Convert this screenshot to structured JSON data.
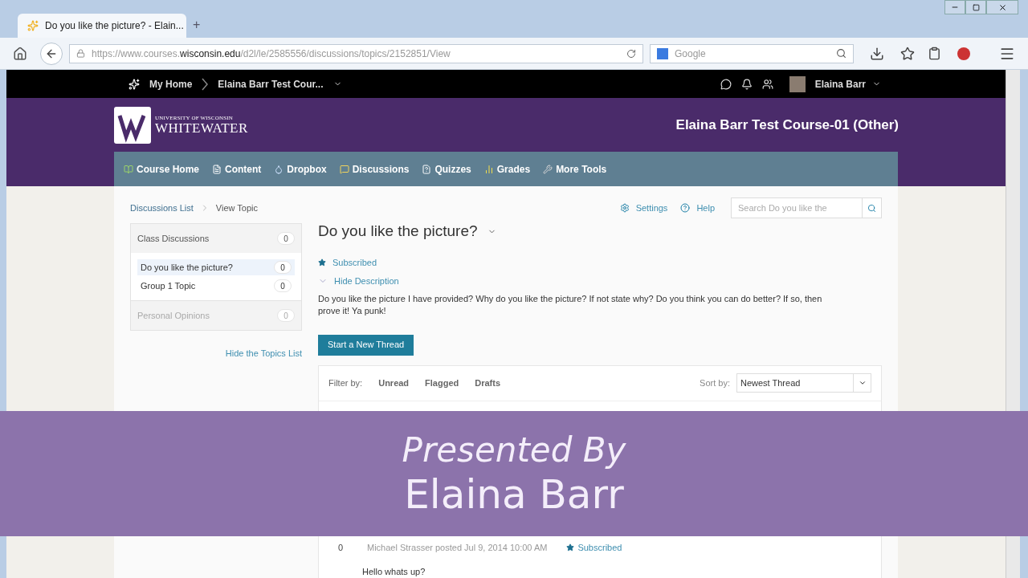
{
  "browser": {
    "tab_title": "Do you like the picture? - Elain...",
    "new_tab": "+",
    "url_prefix": "https://www.courses.",
    "url_domain": "wisconsin.edu",
    "url_rest": "/d2l/le/2585556/discussions/topics/2152851/View",
    "search_placeholder": "Google"
  },
  "topbar": {
    "home": "My Home",
    "course": "Elaina Barr Test Cour...",
    "user": "Elaina Barr"
  },
  "header": {
    "logo_top": "UNIVERSITY OF WISCONSIN",
    "logo_main": "WHITEWATER",
    "course_title": "Elaina Barr Test Course-01 (Other)"
  },
  "nav": [
    {
      "label": "Course Home",
      "kind": "book"
    },
    {
      "label": "Content",
      "kind": "page"
    },
    {
      "label": "Dropbox",
      "kind": "drop"
    },
    {
      "label": "Discussions",
      "kind": "chat"
    },
    {
      "label": "Quizzes",
      "kind": "quiz"
    },
    {
      "label": "Grades",
      "kind": "grade"
    },
    {
      "label": "More Tools",
      "kind": "tools"
    }
  ],
  "breadcrumbs": [
    "Discussions List",
    "View Topic"
  ],
  "tools": {
    "settings": "Settings",
    "help": "Help",
    "search_placeholder": "Search Do you like the"
  },
  "forums": [
    {
      "name": "Class Discussions",
      "count": "0",
      "disabled": false,
      "topics": [
        {
          "name": "Do you like the picture?",
          "count": "0",
          "selected": true
        },
        {
          "name": "Group 1 Topic",
          "count": "0",
          "selected": false
        }
      ]
    },
    {
      "name": "Personal Opinions",
      "count": "0",
      "disabled": true
    }
  ],
  "hide_topics": "Hide the Topics List",
  "topic": {
    "title": "Do you like the picture?",
    "subscribed": "Subscribed",
    "hide_description": "Hide Description",
    "description": "Do you like the picture I have provided? Why do you like the picture? If not state why? Do you think you can do better? If so, then prove it! Ya punk!",
    "new_thread": "Start a New Thread"
  },
  "filter": {
    "label": "Filter by:",
    "options": [
      "Unread",
      "Flagged",
      "Drafts"
    ],
    "sort_label": "Sort by:",
    "sort_value": "Newest Thread"
  },
  "visible_thread": {
    "count": "0",
    "meta": "Michael Strasser posted Jul 9, 2014 10:00 AM",
    "subscribed": "Subscribed",
    "body": "Hello whats up?"
  },
  "overlay": {
    "line1": "Presented By",
    "line2": "Elaina Barr"
  }
}
